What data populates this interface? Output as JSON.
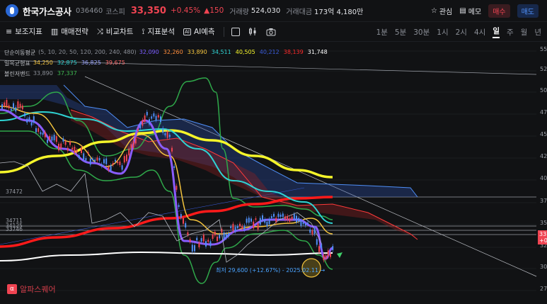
{
  "header": {
    "stock_name": "한국가스공사",
    "stock_code": "036460",
    "market": "코스피",
    "price": "33,350",
    "change_pct": "+0.45%",
    "change_abs": "▲150",
    "volume_label": "거래량",
    "volume_value": "524,030",
    "amount_label": "거래대금",
    "amount_value": "173억 4,180만",
    "favorite_label": "관심",
    "memo_label": "메모",
    "buy_label": "매수",
    "sell_label": "매도"
  },
  "toolbar": {
    "indicators_label": "보조지표",
    "strategy_label": "매매전략",
    "compare_label": "비교차트",
    "analysis_label": "지표분석",
    "ai_label": "AI예측",
    "periods": [
      "1분",
      "5분",
      "30분",
      "1시",
      "2시",
      "4시",
      "일",
      "주",
      "월",
      "년"
    ],
    "active_period": "일"
  },
  "legend": {
    "ma": {
      "name": "단순이동평균",
      "params": "(5, 10, 20, 50, 120, 200, 240, 480)",
      "values": [
        {
          "v": "32,090",
          "color": "#7b5cff"
        },
        {
          "v": "32,260",
          "color": "#ff8c3a"
        },
        {
          "v": "33,890",
          "color": "#f3c33d"
        },
        {
          "v": "34,511",
          "color": "#2fd4d4"
        },
        {
          "v": "40,505",
          "color": "#f5f52a"
        },
        {
          "v": "40,212",
          "color": "#3a5bd9"
        },
        {
          "v": "38,139",
          "color": "#ff2a2a"
        },
        {
          "v": "31,748",
          "color": "#ffffff"
        }
      ]
    },
    "ichimoku": {
      "name": "일목균형표",
      "values": [
        {
          "v": "34,250",
          "color": "#f3c33d"
        },
        {
          "v": "32,875",
          "color": "#2fd4d4"
        },
        {
          "v": "36,825",
          "color": "#9aa4ff"
        },
        {
          "v": "39,675",
          "color": "#ff6b6b"
        }
      ]
    },
    "bollinger": {
      "name": "볼린저밴드",
      "values": [
        {
          "v": "33,890",
          "color": "#8a8e96"
        },
        {
          "v": "37,337",
          "color": "#3fb950"
        }
      ]
    }
  },
  "axis": {
    "labels": [
      "55",
      "52",
      "50",
      "47",
      "45",
      "42",
      "40",
      "37",
      "35",
      "32",
      "30",
      "27"
    ]
  },
  "price_tag": {
    "top": "33",
    "bottom": "+0."
  },
  "levels": [
    "37472",
    "34711",
    "34125",
    "33746"
  ],
  "low_annotation": "최저 29,600 (+12.67%) - 2025.02.11 →",
  "watermark": "알파스퀘어",
  "colors": {
    "up": "#f04452",
    "down": "#4f8ff7",
    "background": "#111214"
  }
}
